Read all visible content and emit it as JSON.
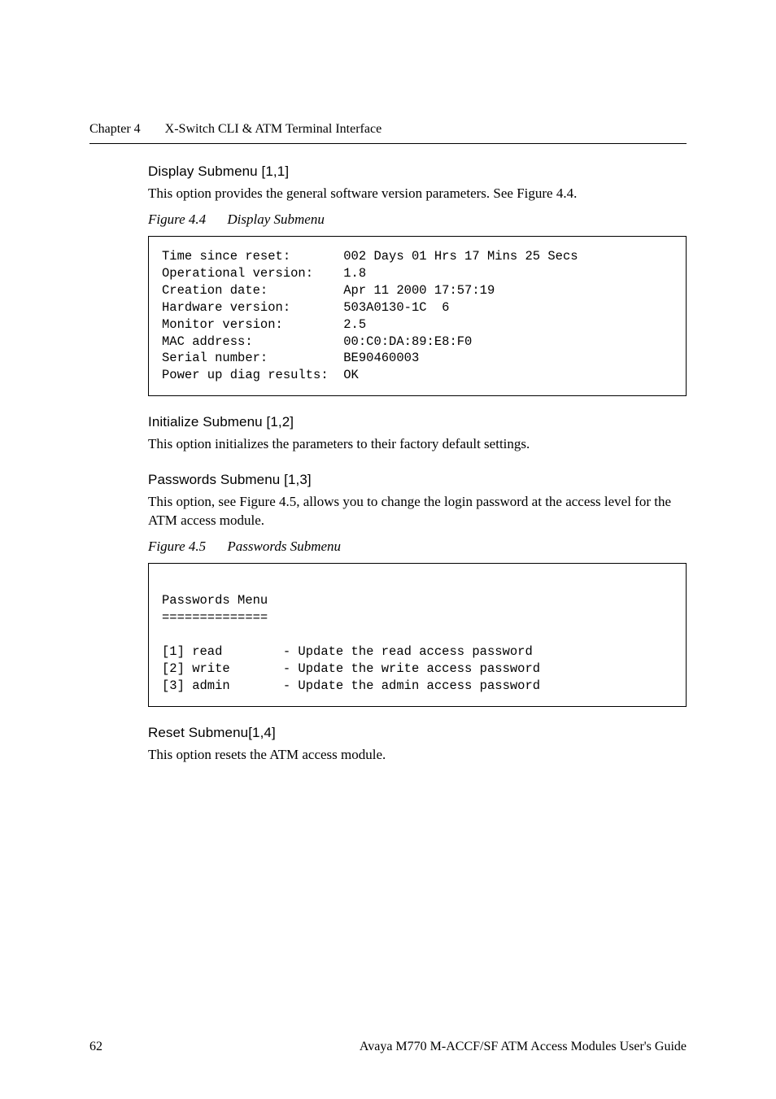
{
  "runningHead": {
    "chapter": "Chapter 4",
    "title": "X-Switch CLI & ATM Terminal Interface"
  },
  "sections": {
    "display": {
      "heading": "Display Submenu [1,1]",
      "body": "This option provides the general software version parameters. See Figure 4.4.",
      "figCaptionLabel": "Figure 4.4",
      "figCaptionText": "Display Submenu",
      "code": "Time since reset:       002 Days 01 Hrs 17 Mins 25 Secs\nOperational version:    1.8\nCreation date:          Apr 11 2000 17:57:19\nHardware version:       503A0130-1C  6\nMonitor version:        2.5\nMAC address:            00:C0:DA:89:E8:F0\nSerial number:          BE90460003\nPower up diag results:  OK"
    },
    "initialize": {
      "heading": "Initialize Submenu [1,2]",
      "body": "This option initializes the parameters to their factory default settings."
    },
    "passwords": {
      "heading": "Passwords Submenu [1,3]",
      "body": "This option, see Figure 4.5, allows you to change the login password at the access level for the ATM access module.",
      "figCaptionLabel": "Figure 4.5",
      "figCaptionText": "Passwords Submenu",
      "code": "\nPasswords Menu\n==============\n\n[1] read        - Update the read access password\n[2] write       - Update the write access password\n[3] admin       - Update the admin access password"
    },
    "reset": {
      "heading": "Reset Submenu[1,4]",
      "body": "This option resets the ATM access module."
    }
  },
  "footer": {
    "pageNumber": "62",
    "docTitle": "Avaya M770 M-ACCF/SF ATM Access Modules User's Guide"
  }
}
